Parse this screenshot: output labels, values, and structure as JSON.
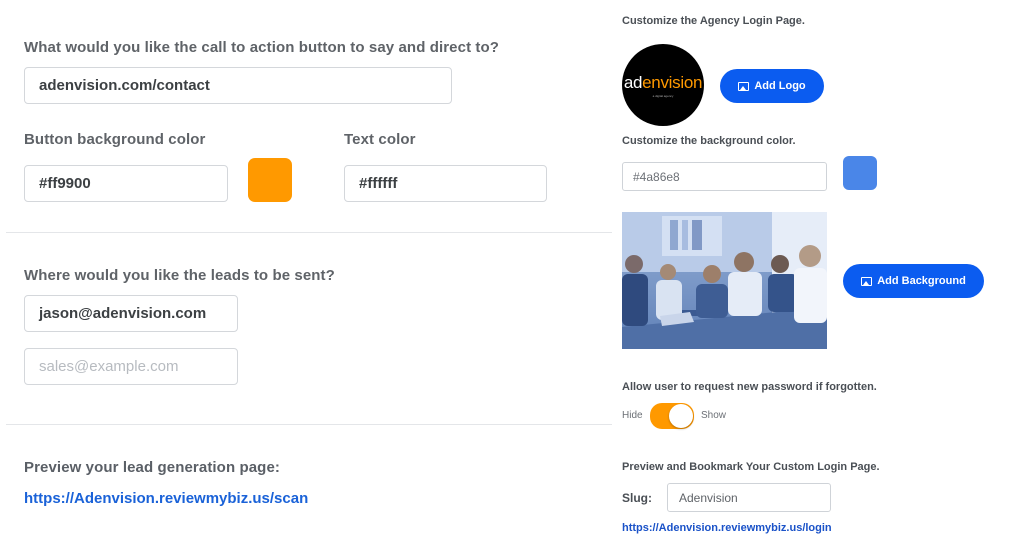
{
  "left": {
    "cta_question": "What would you like the call to action button to say and direct to?",
    "cta_value": "adenvision.com/contact",
    "button_bg_label": "Button background color",
    "button_bg_value": "#ff9900",
    "button_bg_swatch": "#ff9900",
    "text_color_label": "Text color",
    "text_color_value": "#ffffff",
    "leads_question": "Where would you like the leads to be sent?",
    "leads_email_1": "jason@adenvision.com",
    "leads_email_2_placeholder": "sales@example.com",
    "preview_label": "Preview your lead generation page:",
    "preview_link": "https://Adenvision.reviewmybiz.us/scan"
  },
  "right": {
    "login_page_title": "Customize the Agency Login Page.",
    "logo": {
      "brand_ad": "ad",
      "brand_rest": "envision",
      "tagline": "a digital agency"
    },
    "add_logo_label": "Add Logo",
    "bg_color_label": "Customize the background color.",
    "bg_color_value": "#4a86e8",
    "bg_color_swatch": "#4a86e8",
    "add_background_label": "Add Background",
    "password_label": "Allow user to request new password if forgotten.",
    "toggle_hide": "Hide",
    "toggle_show": "Show",
    "toggle_state": "Show",
    "preview_title": "Preview and Bookmark Your Custom Login Page.",
    "slug_label": "Slug:",
    "slug_value": "Adenvision",
    "login_link": "https://Adenvision.reviewmybiz.us/login"
  }
}
